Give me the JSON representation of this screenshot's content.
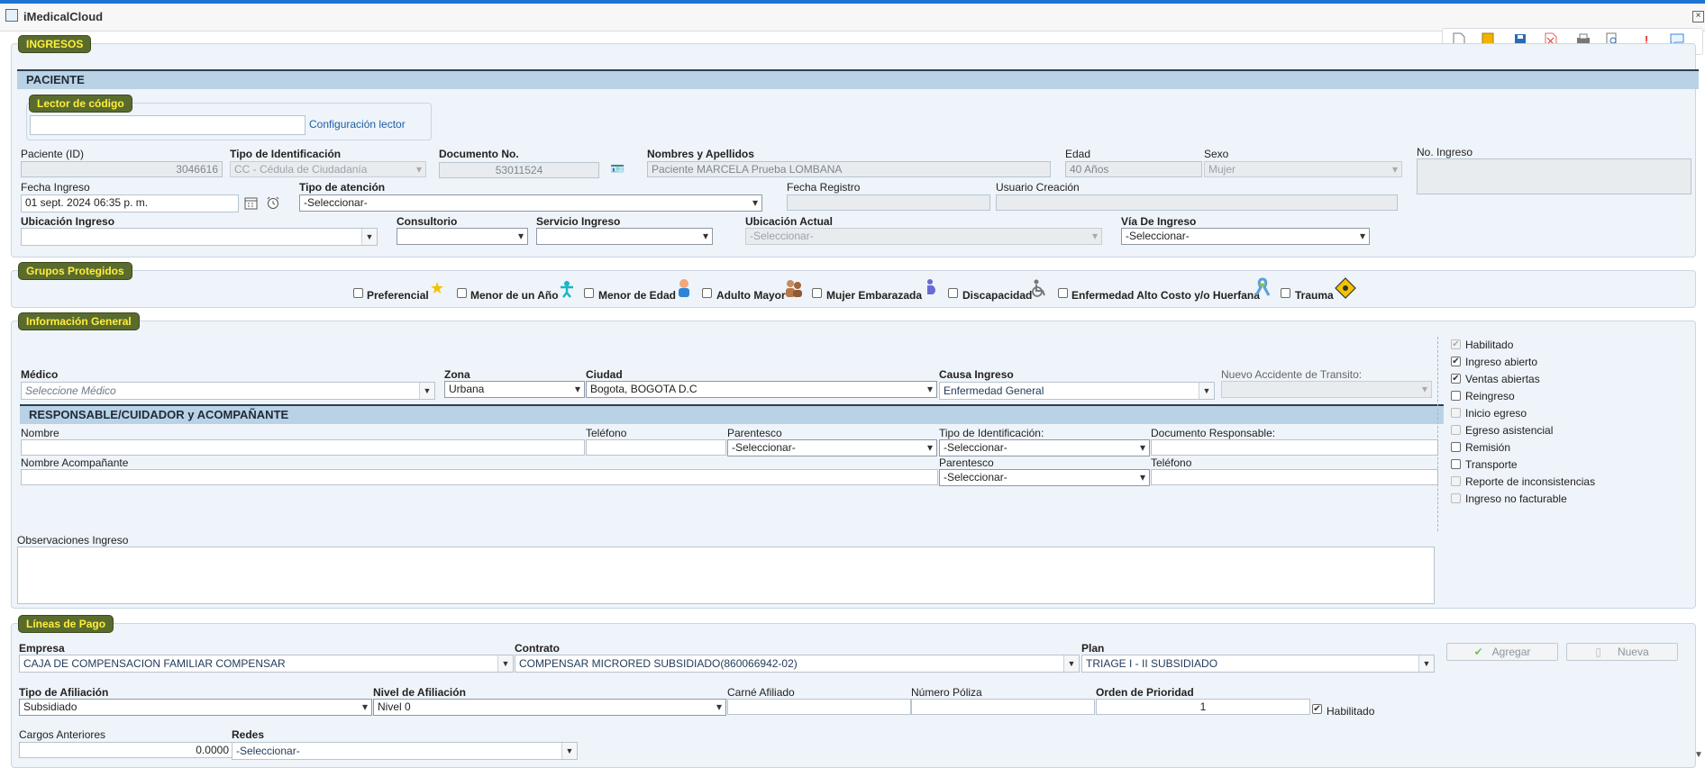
{
  "window": {
    "title": "iMedicalCloud"
  },
  "sections": {
    "ingresos": "INGRESOS",
    "paciente": "PACIENTE",
    "lector": "Lector de código",
    "grupos": "Grupos Protegidos",
    "info": "Información General",
    "responsable": "RESPONSABLE/CUIDADOR y ACOMPAÑANTE",
    "lineas": "Líneas de Pago"
  },
  "lector": {
    "config_link": "Configuración lector",
    "value": ""
  },
  "paciente": {
    "id_label": "Paciente (ID)",
    "id_value": "3046616",
    "tipo_id_label": "Tipo de Identificación",
    "tipo_id_value": "CC - Cédula de Ciudadanía",
    "doc_label": "Documento No.",
    "doc_value": "53011524",
    "nombres_label": "Nombres y Apellidos",
    "nombres_value": "Paciente MARCELA Prueba LOMBANA",
    "edad_label": "Edad",
    "edad_value": "40  Años",
    "sexo_label": "Sexo",
    "sexo_value": "Mujer",
    "no_ingreso_label": "No. Ingreso",
    "fecha_ingreso_label": "Fecha Ingreso",
    "fecha_ingreso_value": "01 sept. 2024 06:35 p. m.",
    "tipo_atencion_label": "Tipo de atención",
    "tipo_atencion_value": "-Seleccionar-",
    "fecha_registro_label": "Fecha Registro",
    "usuario_creacion_label": "Usuario Creación",
    "ubicacion_ingreso_label": "Ubicación Ingreso",
    "consultorio_label": "Consultorio",
    "servicio_ingreso_label": "Servicio Ingreso",
    "ubicacion_actual_label": "Ubicación Actual",
    "ubicacion_actual_value": "-Seleccionar-",
    "via_ingreso_label": "Vía De Ingreso",
    "via_ingreso_value": "-Seleccionar-"
  },
  "grupos": {
    "items": [
      "Preferencial",
      "Menor de un Año",
      "Menor de Edad",
      "Adulto Mayor",
      "Mujer Embarazada",
      "Discapacidad",
      "Enfermedad Alto Costo y/o Huerfana",
      "Trauma"
    ]
  },
  "info": {
    "medico_label": "Médico",
    "medico_placeholder": "Seleccione Médico",
    "zona_label": "Zona",
    "zona_value": "Urbana",
    "ciudad_label": "Ciudad",
    "ciudad_value": "Bogota, BOGOTA D.C",
    "causa_label": "Causa Ingreso",
    "causa_value": "Enfermedad General",
    "accidente_label": "Nuevo Accidente de Transito:",
    "nombre_label": "Nombre",
    "telefono_label": "Teléfono",
    "parentesco_label": "Parentesco",
    "parentesco_value": "-Seleccionar-",
    "tipo_id_label": "Tipo de Identificación:",
    "tipo_id_value": "-Seleccionar-",
    "doc_resp_label": "Documento Responsable:",
    "nombre_acomp_label": "Nombre Acompañante",
    "parentesco2_label": "Parentesco",
    "parentesco2_value": "-Seleccionar-",
    "telefono2_label": "Teléfono",
    "observaciones_label": "Observaciones Ingreso"
  },
  "flags": [
    {
      "label": "Habilitado",
      "checked": true,
      "disabled": true
    },
    {
      "label": "Ingreso abierto",
      "checked": true,
      "disabled": false
    },
    {
      "label": "Ventas abiertas",
      "checked": true,
      "disabled": false
    },
    {
      "label": "Reingreso",
      "checked": false,
      "disabled": false
    },
    {
      "label": "Inicio egreso",
      "checked": false,
      "disabled": true
    },
    {
      "label": "Egreso asistencial",
      "checked": false,
      "disabled": true
    },
    {
      "label": "Remisión",
      "checked": false,
      "disabled": false
    },
    {
      "label": "Transporte",
      "checked": false,
      "disabled": false
    },
    {
      "label": "Reporte de inconsistencias",
      "checked": false,
      "disabled": true
    },
    {
      "label": "Ingreso no facturable",
      "checked": false,
      "disabled": true
    }
  ],
  "pago": {
    "empresa_label": "Empresa",
    "empresa_value": "CAJA DE COMPENSACION FAMILIAR COMPENSAR",
    "contrato_label": "Contrato",
    "contrato_value": "COMPENSAR MICRORED SUBSIDIADO(860066942-02)",
    "plan_label": "Plan",
    "plan_value": "TRIAGE I - II SUBSIDIADO",
    "agregar": "Agregar",
    "nueva": "Nueva",
    "tipo_afil_label": "Tipo de Afiliación",
    "tipo_afil_value": "Subsidiado",
    "nivel_label": "Nivel de Afiliación",
    "nivel_value": "Nivel 0",
    "carne_label": "Carné Afiliado",
    "poliza_label": "Número Póliza",
    "orden_label": "Orden de Prioridad",
    "orden_value": "1",
    "habilitado_label": "Habilitado",
    "cargos_label": "Cargos Anteriores",
    "cargos_value": "0.0000",
    "redes_label": "Redes",
    "redes_value": "-Seleccionar-"
  },
  "colors": {
    "accent": "#5a6b2e",
    "tag_text": "#ffef3a",
    "band": "#b9d2e6",
    "topbar": "#1f74d1"
  }
}
